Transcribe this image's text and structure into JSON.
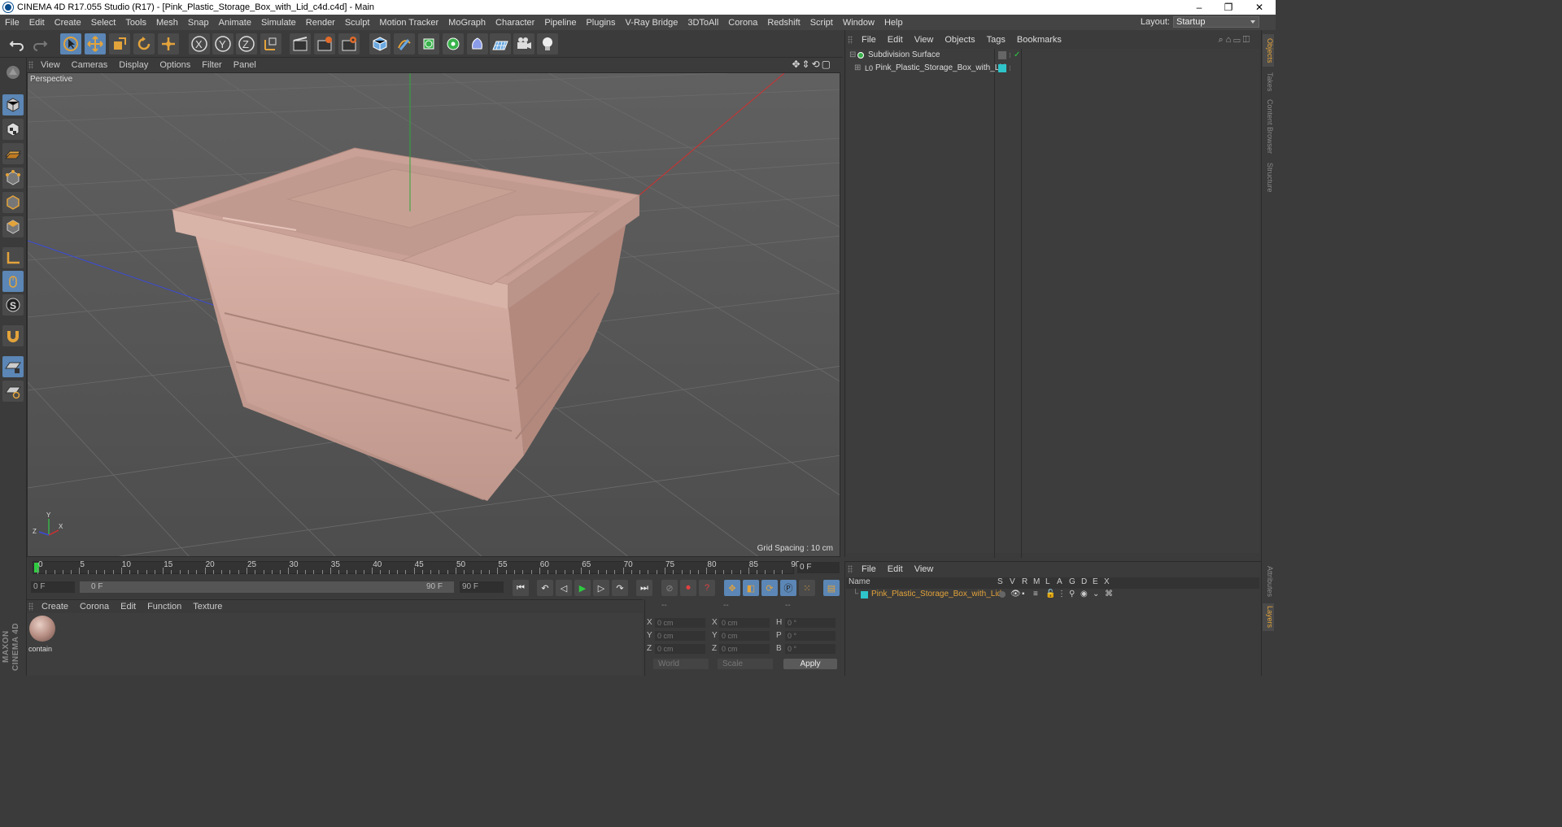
{
  "window": {
    "title": "CINEMA 4D R17.055 Studio (R17) - [Pink_Plastic_Storage_Box_with_Lid_c4d.c4d] - Main",
    "controls": [
      "–",
      "❐",
      "✕"
    ]
  },
  "menubar": {
    "items": [
      "File",
      "Edit",
      "Create",
      "Select",
      "Tools",
      "Mesh",
      "Snap",
      "Animate",
      "Simulate",
      "Render",
      "Sculpt",
      "Motion Tracker",
      "MoGraph",
      "Character",
      "Pipeline",
      "Plugins",
      "V-Ray Bridge",
      "3DToAll",
      "Corona",
      "Redshift",
      "Script",
      "Window",
      "Help"
    ],
    "layout_label": "Layout:",
    "layout_value": "Startup"
  },
  "viewport": {
    "menu": [
      "View",
      "Cameras",
      "Display",
      "Options",
      "Filter",
      "Panel"
    ],
    "label": "Perspective",
    "grid_spacing": "Grid Spacing : 10 cm",
    "axis_labels": {
      "x": "X",
      "y": "Y",
      "z": "Z"
    }
  },
  "toolbar": {
    "axis_buttons": [
      "X",
      "Y",
      "Z"
    ]
  },
  "timeline": {
    "ticks": [
      "0",
      "5",
      "10",
      "15",
      "20",
      "25",
      "30",
      "35",
      "40",
      "45",
      "50",
      "55",
      "60",
      "65",
      "70",
      "75",
      "80",
      "85",
      "90"
    ],
    "current_frame": "0 F",
    "start_field": "0 F",
    "range_start": "0 F",
    "range_end": "90 F",
    "end_field": "90 F"
  },
  "materials": {
    "menu": [
      "Create",
      "Corona",
      "Edit",
      "Function",
      "Texture"
    ],
    "items": [
      {
        "name": "contain"
      }
    ]
  },
  "coordinates": {
    "headers": [
      "--",
      "--",
      "--"
    ],
    "rows": [
      {
        "a_label": "X",
        "a_val": "0 cm",
        "b_label": "X",
        "b_val": "0 cm",
        "c_label": "H",
        "c_val": "0 °"
      },
      {
        "a_label": "Y",
        "a_val": "0 cm",
        "b_label": "Y",
        "b_val": "0 cm",
        "c_label": "P",
        "c_val": "0 °"
      },
      {
        "a_label": "Z",
        "a_val": "0 cm",
        "b_label": "Z",
        "b_val": "0 cm",
        "c_label": "B",
        "c_val": "0 °"
      }
    ],
    "space": "World",
    "mode": "Scale",
    "apply": "Apply"
  },
  "object_manager": {
    "menu": [
      "File",
      "Edit",
      "View",
      "Objects",
      "Tags",
      "Bookmarks"
    ],
    "objects": [
      {
        "name": "Subdivision Surface"
      },
      {
        "name": "Pink_Plastic_Storage_Box_with_Lid"
      }
    ]
  },
  "layer_manager": {
    "menu": [
      "File",
      "Edit",
      "View"
    ],
    "columns": [
      "Name",
      "S",
      "V",
      "R",
      "M",
      "L",
      "A",
      "G",
      "D",
      "E",
      "X"
    ],
    "layers": [
      {
        "name": "Pink_Plastic_Storage_Box_with_Lid"
      }
    ]
  },
  "right_tabs": [
    "Objects",
    "Takes",
    "Content Browser",
    "Structure"
  ],
  "right_tabs_bottom": [
    "Attributes",
    "Layers"
  ],
  "branding": "MAXON CINEMA 4D",
  "colors": {
    "accent": "#e3a33b",
    "active_tool": "#5b86b5",
    "box": "#c9a196",
    "layer_color": "#2ec4c9"
  }
}
